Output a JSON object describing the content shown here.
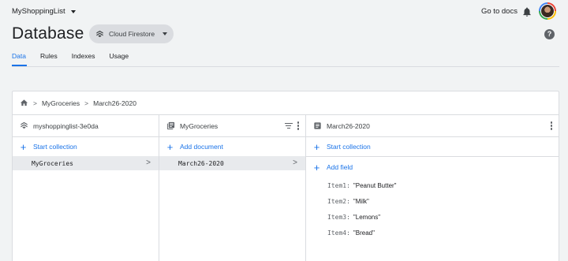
{
  "header": {
    "project_name": "MyShoppingList",
    "docs_link": "Go to docs",
    "title": "Database",
    "db_selector": "Cloud Firestore"
  },
  "tabs": [
    {
      "label": "Data",
      "active": true
    },
    {
      "label": "Rules",
      "active": false
    },
    {
      "label": "Indexes",
      "active": false
    },
    {
      "label": "Usage",
      "active": false
    }
  ],
  "breadcrumb": {
    "items": [
      "MyGroceries",
      "March26-2020"
    ]
  },
  "columns": {
    "root": {
      "title": "myshoppinglist-3e0da",
      "action": "Start collection",
      "items": [
        {
          "label": "MyGroceries",
          "selected": true
        }
      ]
    },
    "collection": {
      "title": "MyGroceries",
      "action": "Add document",
      "items": [
        {
          "label": "March26-2020",
          "selected": true
        }
      ]
    },
    "document": {
      "title": "March26-2020",
      "action_collection": "Start collection",
      "action_field": "Add field",
      "fields": [
        {
          "key": "Item1",
          "value": "\"Peanut Butter\""
        },
        {
          "key": "Item2",
          "value": "\"Milk\""
        },
        {
          "key": "Item3",
          "value": "\"Lemons\""
        },
        {
          "key": "Item4",
          "value": "\"Bread\""
        }
      ]
    }
  },
  "colors": {
    "accent": "#1a73e8",
    "background": "#f1f3f4",
    "selected_row": "#e8eaed"
  },
  "icons": [
    "chevron-down-icon",
    "bell-icon",
    "avatar",
    "firestore-icon",
    "help-icon",
    "home-icon",
    "collection-icon",
    "document-icon",
    "filter-icon",
    "more-vert-icon",
    "add-icon",
    "chevron-right-icon"
  ]
}
